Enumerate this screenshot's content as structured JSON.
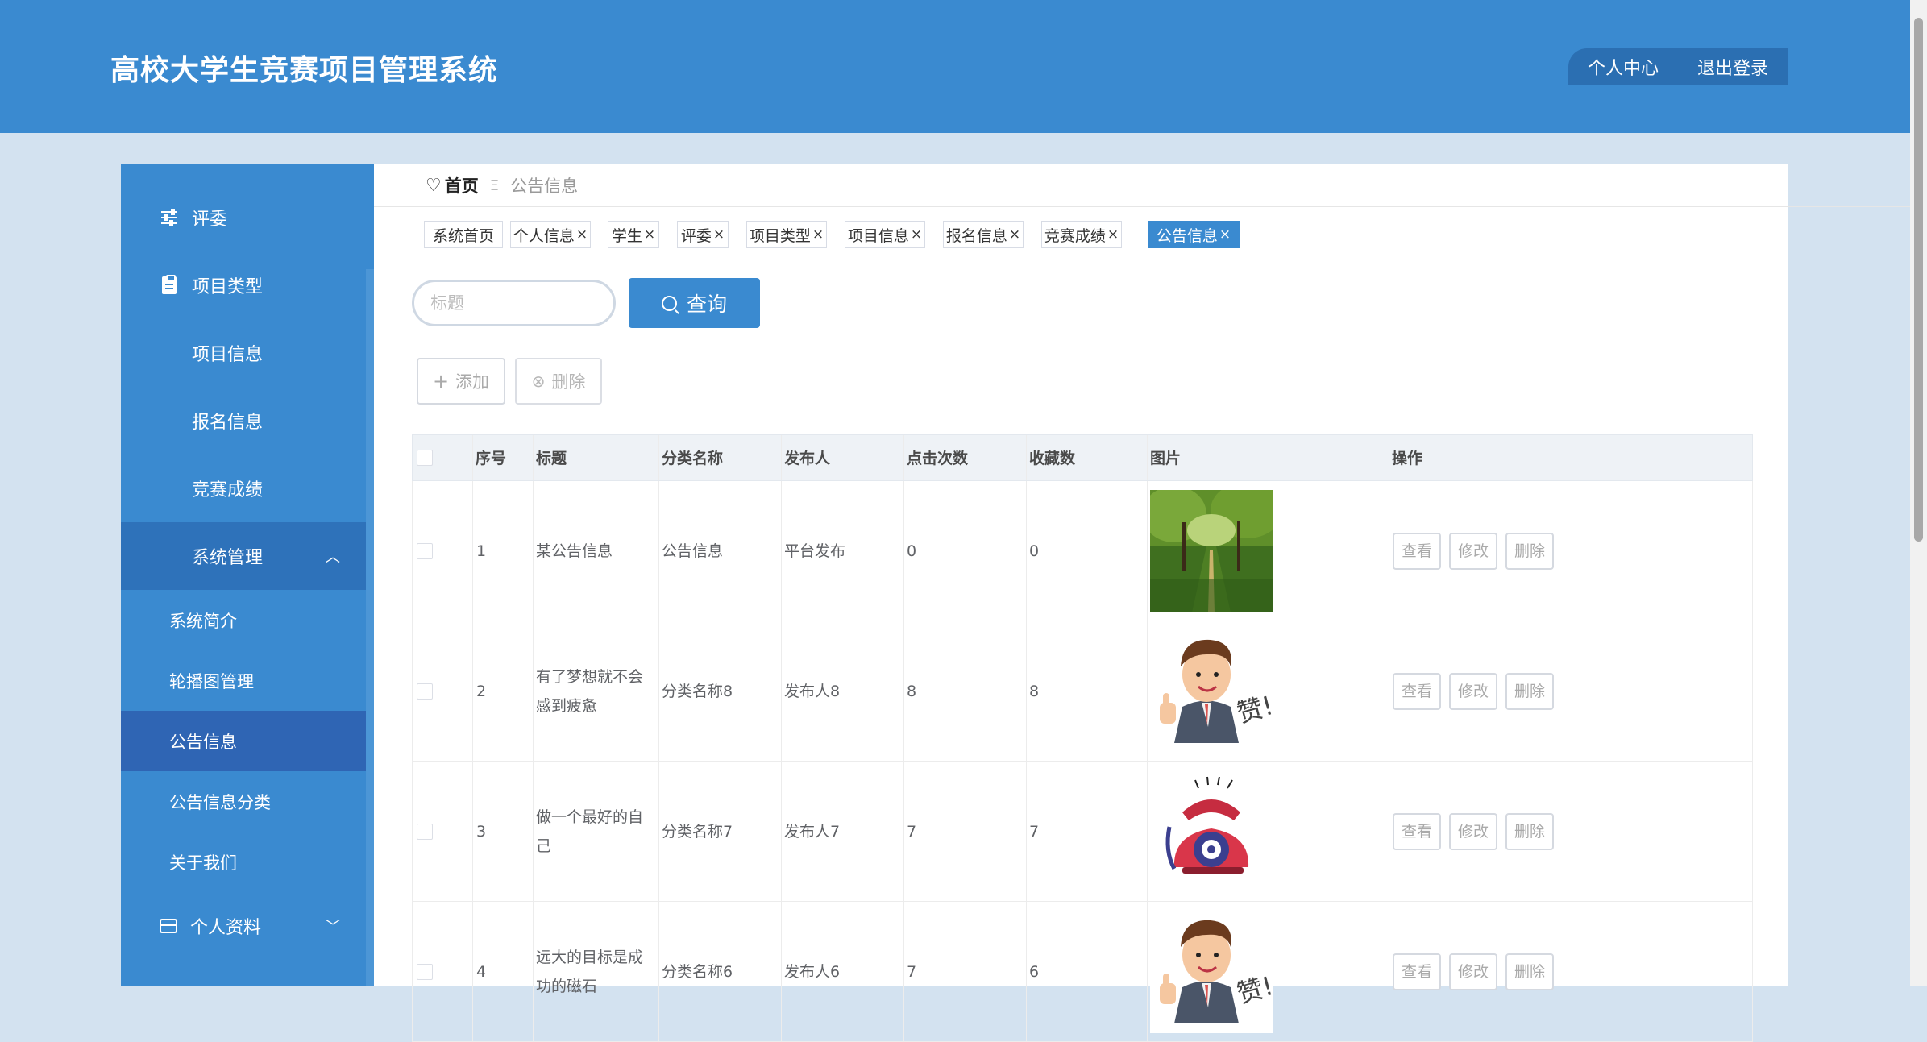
{
  "header": {
    "title": "高校大学生竞赛项目管理系统",
    "profile_label": "个人中心",
    "logout_label": "退出登录"
  },
  "sidebar": {
    "items": [
      {
        "label": "评委",
        "icon": "sliders-icon"
      },
      {
        "label": "项目类型",
        "icon": "clipboard-icon"
      },
      {
        "label": "项目信息",
        "icon": "grid-icon"
      },
      {
        "label": "报名信息",
        "icon": "grid-icon"
      },
      {
        "label": "竞赛成绩",
        "icon": "grid-icon"
      },
      {
        "label": "系统管理",
        "icon": "grid-icon"
      },
      {
        "label": "个人资料",
        "icon": "card-icon"
      }
    ],
    "sub_items": [
      "系统简介",
      "轮播图管理",
      "公告信息",
      "公告信息分类",
      "关于我们"
    ],
    "selected_sub": "公告信息"
  },
  "breadcrumb": {
    "home": "首页",
    "separator": "Ξ",
    "current": "公告信息"
  },
  "tabs": [
    "系统首页",
    "个人信息",
    "学生",
    "评委",
    "项目类型",
    "项目信息",
    "报名信息",
    "竞赛成绩",
    "公告信息"
  ],
  "tab_close": "×",
  "search": {
    "placeholder": "标题",
    "button_label": "查询"
  },
  "actions": {
    "add_label": "添加",
    "delete_label": "删除"
  },
  "table": {
    "headers": [
      "序号",
      "标题",
      "分类名称",
      "发布人",
      "点击次数",
      "收藏数",
      "图片",
      "操作"
    ],
    "rows": [
      {
        "index": "1",
        "title": "某公告信息",
        "category": "公告信息",
        "publisher": "平台发布",
        "clicks": "0",
        "favorites": "0",
        "image": "tree-path-photo"
      },
      {
        "index": "2",
        "title": "有了梦想就不会感到疲惫",
        "category": "分类名称8",
        "publisher": "发布人8",
        "clicks": "8",
        "favorites": "8",
        "image": "thumbs-up-man-cartoon"
      },
      {
        "index": "3",
        "title": "做一个最好的自己",
        "category": "分类名称7",
        "publisher": "发布人7",
        "clicks": "7",
        "favorites": "7",
        "image": "red-telephone-cartoon"
      },
      {
        "index": "4",
        "title": "远大的目标是成功的磁石",
        "category": "分类名称6",
        "publisher": "发布人6",
        "clicks": "7",
        "favorites": "6",
        "image": "thumbs-up-man-cartoon"
      }
    ],
    "row_actions": {
      "view": "查看",
      "edit": "修改",
      "delete": "删除"
    }
  },
  "colors": {
    "primary": "#3a8ad0",
    "sidebar_active": "#2f65b4",
    "page_bg": "#d3e2f0"
  }
}
